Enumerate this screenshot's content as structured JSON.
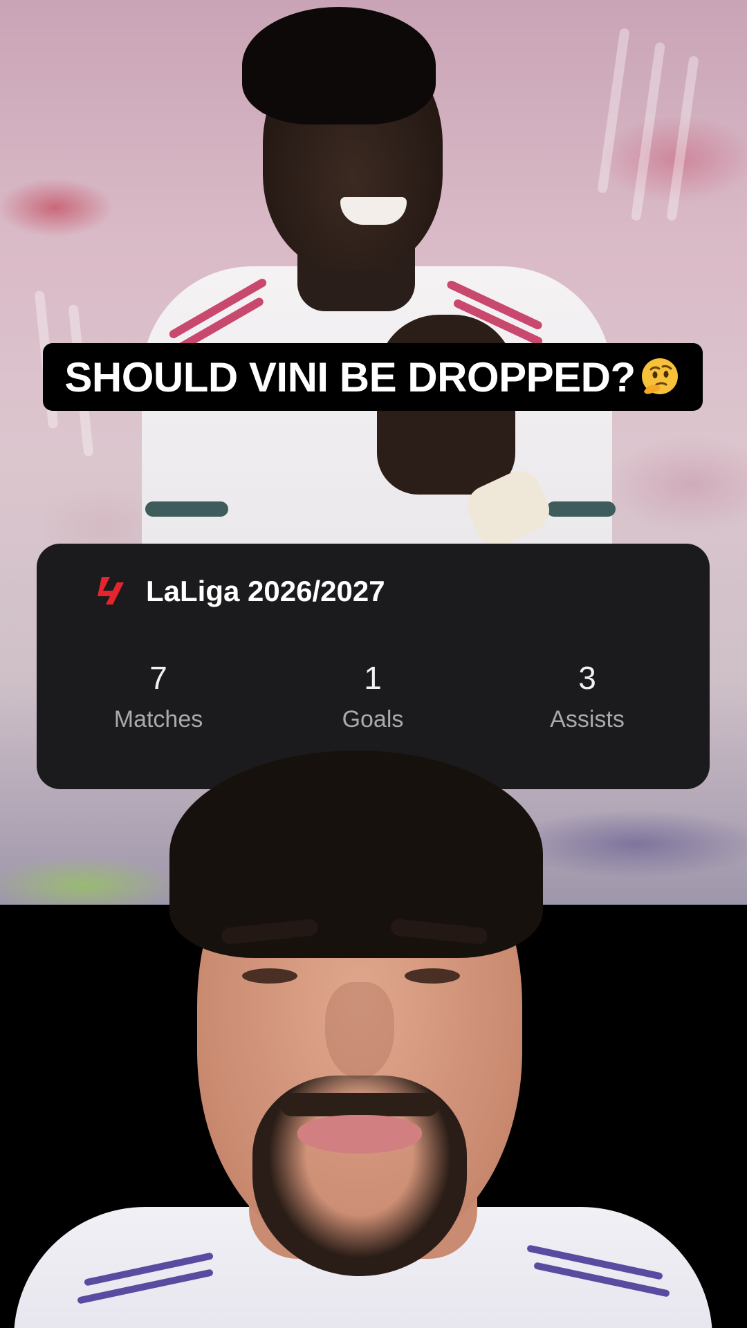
{
  "overlay": {
    "headline": "SHOULD VINI BE DROPPED?",
    "headline_emoji": "thinking-face"
  },
  "stats_card": {
    "league_logo": "laliga-logo",
    "league_title": "LaLiga 2026/2027",
    "stats": [
      {
        "value": "7",
        "label": "Matches"
      },
      {
        "value": "1",
        "label": "Goals"
      },
      {
        "value": "3",
        "label": "Assists"
      }
    ]
  },
  "colors": {
    "card_background": "#1b1b1d",
    "banner_background": "#000000",
    "laliga_red": "#e3262d",
    "stat_label": "#a9a9ae"
  }
}
